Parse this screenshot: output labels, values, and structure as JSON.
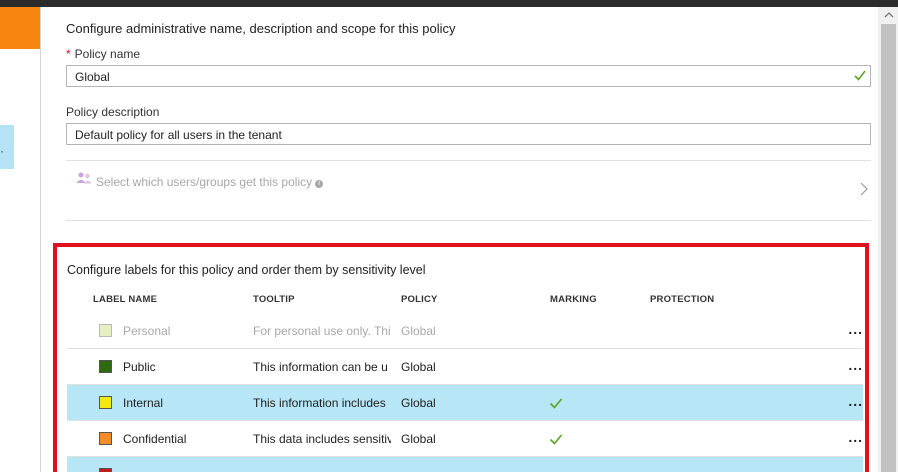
{
  "form": {
    "section_title": "Configure administrative name, description and scope for this policy",
    "required_marker": "*",
    "policy_name_label": "Policy name",
    "policy_name_value": "Global",
    "policy_description_label": "Policy description",
    "policy_description_value": "Default policy for all users in the tenant",
    "select_users_text": "Select which users/groups get this policy",
    "info_glyph": "i"
  },
  "labels_section": {
    "title": "Configure labels for this policy and order them by sensitivity level",
    "columns": {
      "name": "LABEL NAME",
      "tooltip": "TOOLTIP",
      "policy": "POLICY",
      "marking": "MARKING",
      "protection": "PROTECTION"
    },
    "rows": [
      {
        "name": "Personal",
        "tooltip": "For personal use only. Thi",
        "policy": "Global",
        "color": "#e6f0c2",
        "marking": false,
        "disabled": true,
        "selected": false,
        "more": "..."
      },
      {
        "name": "Public",
        "tooltip": "This information can be u",
        "policy": "Global",
        "color": "#2e6b10",
        "marking": false,
        "disabled": false,
        "selected": false,
        "more": "..."
      },
      {
        "name": "Internal",
        "tooltip": "This information includes",
        "policy": "Global",
        "color": "#f2ea10",
        "marking": true,
        "disabled": false,
        "selected": true,
        "more": "..."
      },
      {
        "name": "Confidential",
        "tooltip": "This data includes sensitiv",
        "policy": "Global",
        "color": "#f28c28",
        "marking": true,
        "disabled": false,
        "selected": false,
        "more": "..."
      },
      {
        "name": "",
        "tooltip": "",
        "policy": "",
        "color": "#c01d1d",
        "marking": false,
        "disabled": false,
        "selected": true,
        "more": ""
      }
    ]
  },
  "colors": {
    "accent_orange": "#f7850f",
    "highlight_red": "#e0101f",
    "selected_row": "#b7e6f7",
    "check_green": "#5aa820"
  },
  "icons": {
    "valid": "check-icon",
    "users": "users-icon",
    "navigate": "chevron-right-icon",
    "scroll_up": "arrow-up-icon"
  }
}
